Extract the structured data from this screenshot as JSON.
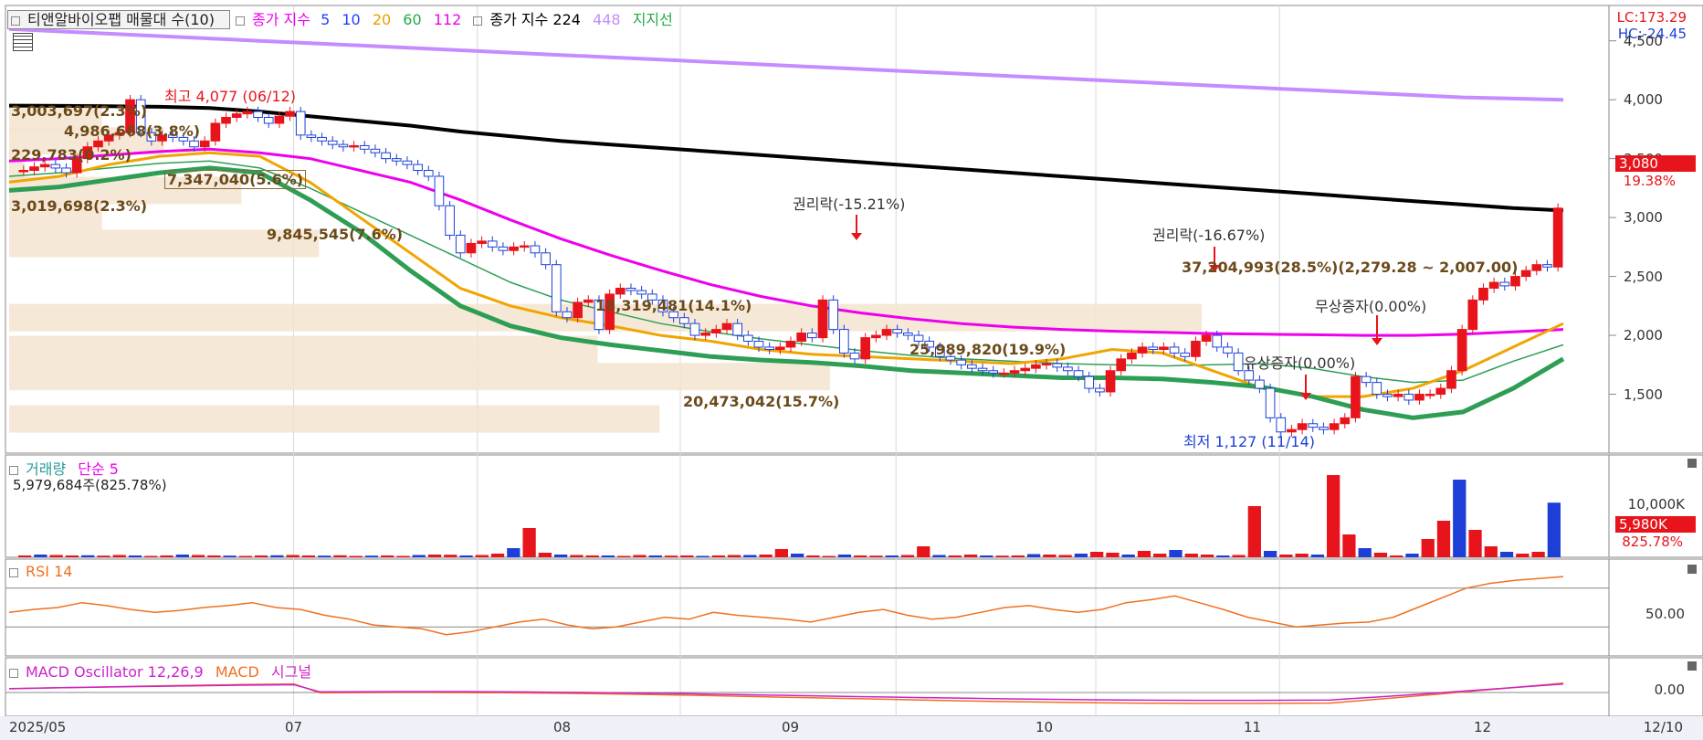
{
  "header": {
    "title_button": "티앤알바이오팹 매물대 수(10)",
    "ma_label": "종가 지수",
    "ma_periods": [
      {
        "label": "5",
        "color": "#1f3fff"
      },
      {
        "label": "10",
        "color": "#1f3fff"
      },
      {
        "label": "20",
        "color": "#e8a000"
      },
      {
        "label": "60",
        "color": "#22aa44"
      },
      {
        "label": "112",
        "color": "#ee00ee"
      }
    ],
    "ma_label2": "종가 지수 224",
    "ma_448": "448",
    "support_label": "지지선"
  },
  "price_axis": {
    "lc": "LC:173.29",
    "hc": "HC:-24.45",
    "ticks": [
      "4,500",
      "4,000",
      "3,500",
      "3,000",
      "2,500",
      "2,000",
      "1,500"
    ],
    "current_price": "3,080",
    "current_change": "19.38%"
  },
  "annotations": {
    "high": "최고 4,077 (06/12)",
    "low": "최저 1,127 (11/14)",
    "rights1": "권리락(-15.21%)",
    "rights2": "권리락(-16.67%)",
    "bonus1": "무상증자(0.00%)",
    "bonus2": "유상증자(0.00%)"
  },
  "volume_profile": [
    {
      "label": "3,003,697(2.3%)",
      "price": 3850,
      "frac": 0.06
    },
    {
      "label": "4,986,668(3.8%)",
      "price": 3650,
      "frac": 0.1
    },
    {
      "label": "229,783(0.2%)",
      "price": 3430,
      "frac": 0.01
    },
    {
      "label": "7,347,040(5.6%)",
      "price": 3230,
      "frac": 0.15
    },
    {
      "label": "3,019,698(2.3%)",
      "price": 3010,
      "frac": 0.06
    },
    {
      "label": "9,845,545(7.6%)",
      "price": 2780,
      "frac": 0.2
    },
    {
      "label": "37,204,993(28.5%)(2,279.28 ~ 2,007.00)",
      "price": 2150,
      "frac": 0.77
    },
    {
      "label": "18,319,481(14.1%)",
      "price": 1880,
      "frac": 0.38
    },
    {
      "label": "25,989,820(19.9%)",
      "price": 1650,
      "frac": 0.53
    },
    {
      "label": "20,473,042(15.7%)",
      "price": 1290,
      "frac": 0.42
    }
  ],
  "volume_panel": {
    "title": "거래량",
    "ma_label": "단순 5",
    "info": "5,979,684주(825.78%)",
    "tick": "10,000K",
    "current": "5,980K",
    "current_pct": "825.78%"
  },
  "rsi_panel": {
    "title": "RSI 14",
    "tick": "50.00"
  },
  "macd_panel": {
    "title": "MACD Oscillator 12,26,9",
    "macd": "MACD",
    "signal": "시그널",
    "tick": "0.00"
  },
  "x_axis": {
    "labels": [
      "2025/05",
      "07",
      "08",
      "09",
      "10",
      "11",
      "12"
    ],
    "right_label": "12/10"
  },
  "colors": {
    "up": "#e8141b",
    "down": "#1d3fd8",
    "ma5": "#1f3fff",
    "ma10": "#5a4fc7",
    "ma20": "#f0a500",
    "ma60": "#2e9e55",
    "ma112": "#ee00ee",
    "ma224": "#000000",
    "ma448": "#c58cff"
  },
  "chart_data": {
    "type": "candlestick",
    "title": "티앤알바이오팹 매물대 수(10)",
    "ylim": [
      1000,
      4800
    ],
    "grid": true,
    "x_labels": [
      "2025/05",
      "07",
      "08",
      "09",
      "10",
      "11",
      "12"
    ],
    "candles_close_approx": [
      3400,
      3430,
      3450,
      3420,
      3380,
      3500,
      3600,
      3650,
      3700,
      3720,
      4000,
      3720,
      3650,
      3700,
      3680,
      3650,
      3600,
      3650,
      3800,
      3850,
      3880,
      3900,
      3850,
      3800,
      3860,
      3900,
      3700,
      3680,
      3650,
      3620,
      3600,
      3610,
      3580,
      3550,
      3500,
      3480,
      3450,
      3400,
      3350,
      3100,
      2850,
      2700,
      2780,
      2800,
      2750,
      2720,
      2750,
      2760,
      2700,
      2600,
      2200,
      2150,
      2280,
      2300,
      2050,
      2350,
      2400,
      2380,
      2350,
      2300,
      2200,
      2150,
      2100,
      2000,
      2020,
      2050,
      2100,
      2000,
      1950,
      1900,
      1880,
      1900,
      1950,
      2020,
      1980,
      2300,
      2050,
      1850,
      1800,
      1980,
      2000,
      2050,
      2020,
      2000,
      1950,
      1900,
      1820,
      1790,
      1750,
      1720,
      1700,
      1680,
      1680,
      1700,
      1720,
      1750,
      1760,
      1730,
      1700,
      1650,
      1550,
      1520,
      1700,
      1800,
      1850,
      1900,
      1880,
      1900,
      1850,
      1820,
      1950,
      2000,
      1900,
      1850,
      1700,
      1620,
      1550,
      1300,
      1180,
      1200,
      1250,
      1220,
      1200,
      1250,
      1300,
      1650,
      1600,
      1500,
      1480,
      1500,
      1450,
      1500,
      1500,
      1550,
      1700,
      2050,
      2300,
      2400,
      2450,
      2420,
      2500,
      2550,
      2600,
      2580,
      3080
    ],
    "series": [
      {
        "name": "448",
        "values": [
          4600,
          4580,
          4560,
          4540,
          4520,
          4500,
          4480,
          4460,
          4440,
          4420,
          4400,
          4380,
          4360,
          4340,
          4320,
          4300,
          4280,
          4260,
          4240,
          4220,
          4200,
          4180,
          4160,
          4140,
          4120,
          4100,
          4080,
          4060,
          4040,
          4020,
          4010,
          4000
        ]
      },
      {
        "name": "224",
        "values": [
          3950,
          3948,
          3945,
          3940,
          3930,
          3900,
          3860,
          3820,
          3780,
          3730,
          3690,
          3650,
          3620,
          3590,
          3560,
          3530,
          3500,
          3470,
          3440,
          3410,
          3380,
          3350,
          3320,
          3290,
          3260,
          3230,
          3200,
          3170,
          3140,
          3110,
          3080,
          3060
        ]
      },
      {
        "name": "112",
        "values": [
          3480,
          3500,
          3530,
          3560,
          3580,
          3550,
          3500,
          3400,
          3300,
          3150,
          2980,
          2820,
          2680,
          2550,
          2430,
          2330,
          2250,
          2190,
          2140,
          2100,
          2070,
          2050,
          2035,
          2025,
          2015,
          2010,
          2005,
          2000,
          2000,
          2010,
          2030,
          2050
        ]
      },
      {
        "name": "60",
        "values": [
          3350,
          3380,
          3420,
          3460,
          3480,
          3420,
          3250,
          3050,
          2850,
          2650,
          2450,
          2300,
          2200,
          2100,
          2030,
          1970,
          1920,
          1870,
          1830,
          1800,
          1780,
          1760,
          1750,
          1740,
          1750,
          1760,
          1720,
          1650,
          1600,
          1620,
          1780,
          1920
        ]
      },
      {
        "name": "20",
        "values": [
          3300,
          3350,
          3450,
          3520,
          3550,
          3520,
          3300,
          3000,
          2700,
          2400,
          2250,
          2150,
          2080,
          2000,
          1950,
          1880,
          1840,
          1820,
          1800,
          1780,
          1760,
          1800,
          1880,
          1850,
          1700,
          1550,
          1480,
          1480,
          1550,
          1700,
          1900,
          2100
        ]
      },
      {
        "name": "지지선",
        "values": [
          3230,
          3260,
          3320,
          3380,
          3420,
          3380,
          3150,
          2880,
          2550,
          2250,
          2080,
          1980,
          1920,
          1870,
          1820,
          1790,
          1770,
          1740,
          1700,
          1680,
          1660,
          1640,
          1640,
          1630,
          1600,
          1560,
          1480,
          1370,
          1300,
          1350,
          1550,
          1800
        ]
      }
    ],
    "volume_K": [
      200,
      300,
      250,
      200,
      220,
      180,
      250,
      200,
      150,
      200,
      300,
      250,
      200,
      180,
      150,
      200,
      220,
      250,
      200,
      180,
      220,
      150,
      180,
      200,
      150,
      250,
      300,
      280,
      200,
      250,
      400,
      1000,
      3200,
      500,
      300,
      250,
      200,
      200,
      150,
      250,
      200,
      180,
      200,
      150,
      200,
      250,
      250,
      300,
      900,
      400,
      200,
      150,
      300,
      200,
      180,
      200,
      250,
      1200,
      250,
      200,
      300,
      200,
      180,
      200,
      350,
      300,
      250,
      400,
      600,
      500,
      300,
      700,
      400,
      800,
      400,
      300,
      200,
      250,
      5600,
      700,
      300,
      400,
      300,
      9000,
      2500,
      1000,
      500,
      200,
      400,
      2000,
      4000,
      8500,
      3000,
      1200,
      600,
      400,
      600,
      5980
    ],
    "rsi": [
      45,
      48,
      50,
      55,
      52,
      48,
      45,
      47,
      50,
      52,
      55,
      50,
      48,
      42,
      38,
      32,
      30,
      28,
      22,
      25,
      30,
      35,
      38,
      32,
      28,
      30,
      35,
      40,
      38,
      45,
      42,
      40,
      38,
      35,
      40,
      45,
      48,
      42,
      38,
      40,
      45,
      50,
      52,
      48,
      45,
      48,
      55,
      58,
      62,
      55,
      48,
      40,
      35,
      30,
      32,
      34,
      35,
      40,
      50,
      60,
      70,
      75,
      78,
      80,
      82
    ]
  }
}
